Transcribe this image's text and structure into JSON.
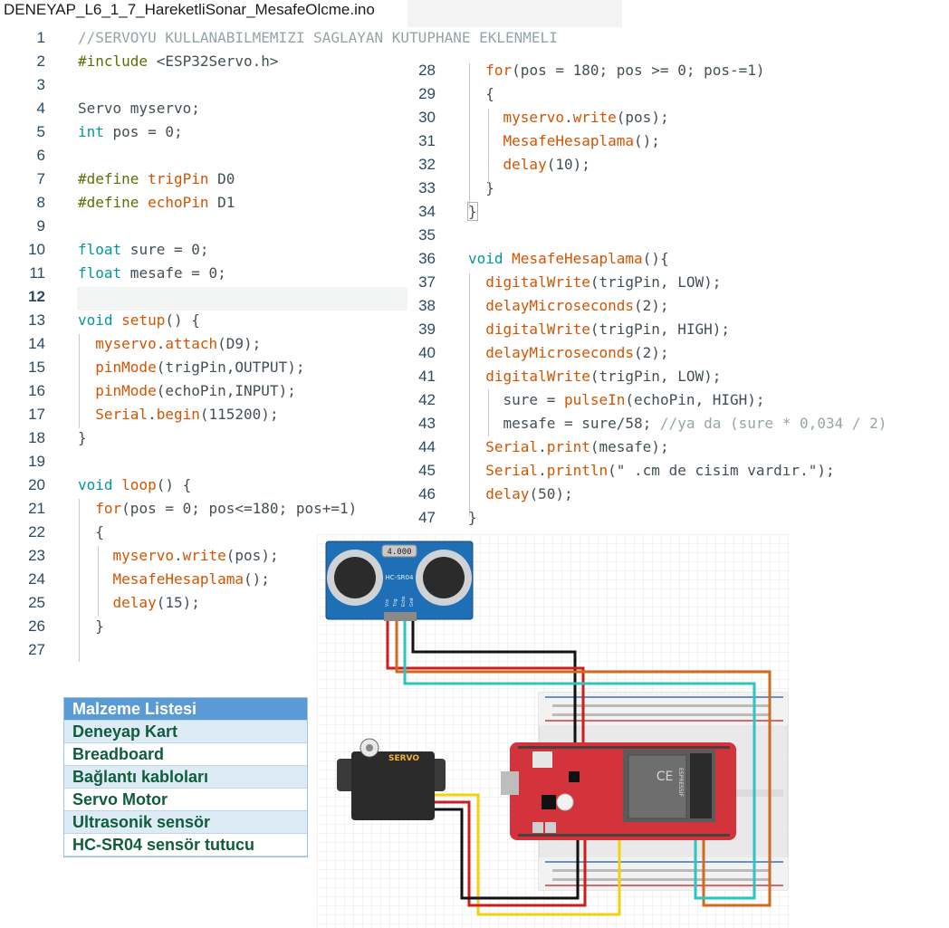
{
  "tab": {
    "title": "DENEYAP_L6_1_7_HareketliSonar_MesafeOlcme.ino"
  },
  "left_code": [
    {
      "n": "1",
      "html": "<span class='c-cmt'>//SERVOYU KULLANABILMEMIZI SAGLAYAN KUTUPHANE EKLENMELI</span>"
    },
    {
      "n": "2",
      "html": "<span class='c-pp'>#include</span> &lt;ESP32Servo.h&gt;"
    },
    {
      "n": "3",
      "html": ""
    },
    {
      "n": "4",
      "html": "Servo myservo;"
    },
    {
      "n": "5",
      "html": "<span class='c-type'>int</span> pos = 0;"
    },
    {
      "n": "6",
      "html": ""
    },
    {
      "n": "7",
      "html": "<span class='c-pp'>#define</span> <span class='c-fn'>trigPin</span> D0"
    },
    {
      "n": "8",
      "html": "<span class='c-pp'>#define</span> <span class='c-fn'>echoPin</span> D1"
    },
    {
      "n": "9",
      "html": ""
    },
    {
      "n": "10",
      "html": "<span class='c-type'>float</span> sure = 0;"
    },
    {
      "n": "11",
      "html": "<span class='c-type'>float</span> mesafe = 0;"
    },
    {
      "n": "12",
      "html": ""
    },
    {
      "n": "13",
      "html": "<span class='c-kw'>void</span> <span class='c-fn'>setup</span>() {"
    },
    {
      "n": "14",
      "html": "  <span class='c-fn'>myservo</span>.<span class='c-fn'>attach</span>(D9);"
    },
    {
      "n": "15",
      "html": "  <span class='c-fn'>pinMode</span>(trigPin,OUTPUT);"
    },
    {
      "n": "16",
      "html": "  <span class='c-fn'>pinMode</span>(echoPin,INPUT);"
    },
    {
      "n": "17",
      "html": "  <span class='c-fn'>Serial</span>.<span class='c-fn'>begin</span>(115200);"
    },
    {
      "n": "18",
      "html": "}"
    },
    {
      "n": "19",
      "html": ""
    },
    {
      "n": "20",
      "html": "<span class='c-kw'>void</span> <span class='c-fn'>loop</span>() {"
    },
    {
      "n": "21",
      "html": "  <span class='c-fn'>for</span>(pos = 0; pos&lt;=180; pos+=1)"
    },
    {
      "n": "22",
      "html": "  {"
    },
    {
      "n": "23",
      "html": "    <span class='c-fn'>myservo</span>.<span class='c-fn'>write</span>(pos);"
    },
    {
      "n": "24",
      "html": "    <span class='c-fn'>MesafeHesaplama</span>();"
    },
    {
      "n": "25",
      "html": "    <span class='c-fn'>delay</span>(15);"
    },
    {
      "n": "26",
      "html": "  }"
    },
    {
      "n": "27",
      "html": ""
    }
  ],
  "right_code": [
    {
      "n": "28",
      "html": "  <span class='c-fn'>for</span>(pos = 180; pos &gt;= 0; pos-=1)"
    },
    {
      "n": "29",
      "html": "  {"
    },
    {
      "n": "30",
      "html": "    <span class='c-fn'>myservo</span>.<span class='c-fn'>write</span>(pos);"
    },
    {
      "n": "31",
      "html": "    <span class='c-fn'>MesafeHesaplama</span>();"
    },
    {
      "n": "32",
      "html": "    <span class='c-fn'>delay</span>(10);"
    },
    {
      "n": "33",
      "html": "  }"
    },
    {
      "n": "34",
      "html": "<span class='brace-box'>}</span>"
    },
    {
      "n": "35",
      "html": ""
    },
    {
      "n": "36",
      "html": "<span class='c-kw'>void</span> <span class='c-fn'>MesafeHesaplama</span>(){"
    },
    {
      "n": "37",
      "html": "  <span class='c-fn'>digitalWrite</span>(trigPin, LOW);"
    },
    {
      "n": "38",
      "html": "  <span class='c-fn'>delayMicroseconds</span>(2);"
    },
    {
      "n": "39",
      "html": "  <span class='c-fn'>digitalWrite</span>(trigPin, HIGH);"
    },
    {
      "n": "40",
      "html": "  <span class='c-fn'>delayMicroseconds</span>(2);"
    },
    {
      "n": "41",
      "html": "  <span class='c-fn'>digitalWrite</span>(trigPin, LOW);"
    },
    {
      "n": "42",
      "html": "    sure = <span class='c-fn'>pulseIn</span>(echoPin, HIGH);"
    },
    {
      "n": "43",
      "html": "    mesafe = sure/58; <span class='c-cmt'>//ya da (sure * 0,034 / 2)</span>"
    },
    {
      "n": "44",
      "html": "  <span class='c-fn'>Serial</span>.<span class='c-fn'>print</span>(mesafe);"
    },
    {
      "n": "45",
      "html": "  <span class='c-fn'>Serial</span>.<span class='c-fn'>println</span>(\" .cm de cisim vardır.\");"
    },
    {
      "n": "46",
      "html": "  <span class='c-fn'>delay</span>(50);"
    },
    {
      "n": "47",
      "html": "}"
    }
  ],
  "materials": {
    "header": "Malzeme Listesi",
    "items": [
      "Deneyap Kart",
      "Breadboard",
      "Bağlantı kabloları",
      "Servo Motor",
      "Ultrasonik sensör",
      "HC-SR04 sensör tutucu"
    ]
  },
  "circuit": {
    "sensor_crystal": "4.000",
    "sensor_model": "HC-SR04",
    "sensor_pins": [
      "Vcc",
      "Trig",
      "Echo",
      "Gnd"
    ],
    "servo_label": "SERVO",
    "board_ce": "CE",
    "module_brand": "ESPRESSIF",
    "colors": {
      "board": "#d3343b",
      "sensor": "#1f6fb6",
      "servo": "#2b2b2b",
      "wire_red": "#c81e1e",
      "wire_orange": "#d2691e",
      "wire_teal": "#2cc4c4",
      "wire_black": "#111111",
      "wire_yellow": "#f2d10f"
    }
  }
}
